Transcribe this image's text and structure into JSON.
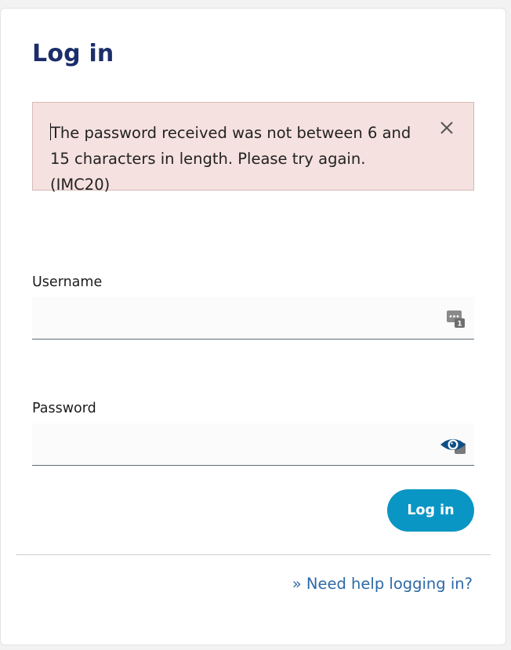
{
  "form": {
    "title": "Log in",
    "error_message": "The password received was not between 6 and 15 characters in length. Please try again. (IMC20)",
    "username_label": "Username",
    "username_value": "",
    "password_label": "Password",
    "password_value": "",
    "submit_label": "Log in",
    "help_link": "» Need help logging in?"
  },
  "icons": {
    "alert_close": "close-icon",
    "username_field": "password-manager-icon",
    "password_field": "eye-icon"
  },
  "colors": {
    "title": "#1c2d6b",
    "alert_background": "#f5e1df",
    "alert_border": "#d7b9b6",
    "button": "#0a96c4",
    "link": "#2d6aa6",
    "eye_icon": "#0f4f85"
  }
}
